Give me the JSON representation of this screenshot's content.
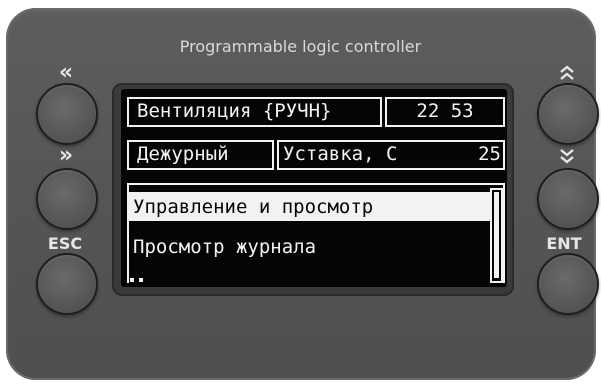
{
  "device": {
    "title": "Programmable logic controller"
  },
  "buttons": {
    "left": [
      {
        "label": "«",
        "icon": "double-chevron-left-icon"
      },
      {
        "label": "»",
        "icon": "double-chevron-right-icon"
      },
      {
        "label": "ESC",
        "icon": ""
      }
    ],
    "right": [
      {
        "label": "",
        "icon": "double-chevron-up-icon"
      },
      {
        "label": "",
        "icon": "double-chevron-down-icon"
      },
      {
        "label": "ENT",
        "icon": ""
      }
    ]
  },
  "display": {
    "row1": {
      "mode": "Вентиляция {РУЧН}",
      "time": "22 53"
    },
    "row2": {
      "state": "Дежурный",
      "setpoint_label": "Уставка, С",
      "setpoint_value": "25"
    },
    "menu": {
      "items": [
        "Управление и просмотр",
        "Просмотр журнала"
      ],
      "selected_index": 0
    }
  },
  "colors": {
    "panel": "#565656",
    "screen_bg": "#050505",
    "screen_fg": "#f2f2f2",
    "label": "#e6e6e6"
  }
}
